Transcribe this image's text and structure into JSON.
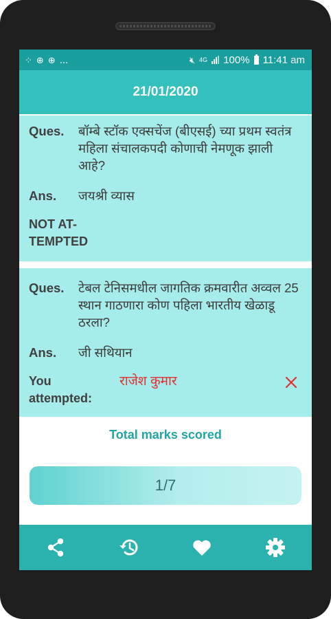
{
  "status_bar": {
    "left_text": "...",
    "network": "4G",
    "battery": "100%",
    "time": "11:41 am"
  },
  "header": {
    "title": "21/01/2020"
  },
  "questions": [
    {
      "ques_label": "Ques.",
      "question": "बॉम्बे स्टॉक एक्सचेंज (बीएसई) च्या प्रथम स्वतंत्र महिला संचालकपदी कोणाची नेमणूक झाली आहे?",
      "ans_label": "Ans.",
      "answer": "जयश्री व्यास",
      "status": "NOT AT-TEMPTED"
    },
    {
      "ques_label": "Ques.",
      "question": "टेबल टेनिसमधील जागतिक क्रमवारीत अव्वल 25 स्थान गाठणारा कोण पहिला भारतीय खेळाडू ठरला?",
      "ans_label": "Ans.",
      "answer": "जी सथियान",
      "attempt_label": "You attempted:",
      "attempt_value": "राजेश कुमार",
      "result_icon": "wrong-cross-icon",
      "result_color": "#e03030"
    }
  ],
  "score": {
    "label": "Total marks scored",
    "value": "1/7"
  },
  "bottom_nav": [
    {
      "name": "share-icon"
    },
    {
      "name": "history-icon"
    },
    {
      "name": "heart-icon"
    },
    {
      "name": "settings-icon"
    }
  ],
  "colors": {
    "primary": "#34c0bc",
    "status_bar": "#1a9e9e",
    "card": "#a6ecea",
    "bottom_bar": "#2bb2ae",
    "accent_text": "#23a5a3"
  }
}
